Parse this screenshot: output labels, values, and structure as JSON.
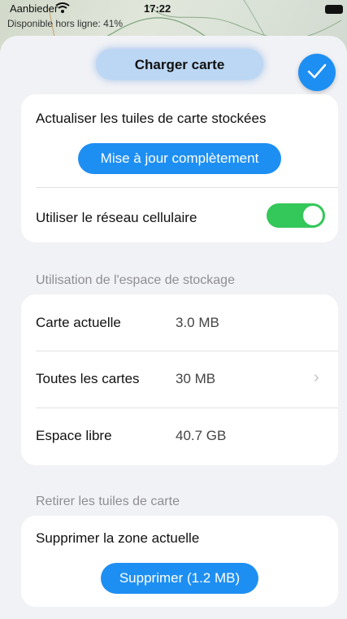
{
  "status_bar": {
    "carrier": "Aanbieder",
    "time": "17:22",
    "offline_notice": "Disponible hors ligne: 41%"
  },
  "header": {
    "title": "Charger carte",
    "done_icon": "checkmark-icon"
  },
  "update_section": {
    "refresh_label": "Actualiser les tuiles de carte stockées",
    "update_button": "Mise à jour complètement",
    "cellular_label": "Utiliser le réseau cellulaire",
    "cellular_enabled": true
  },
  "storage_section": {
    "header": "Utilisation de l'espace de stockage",
    "rows": [
      {
        "label": "Carte actuelle",
        "value": "3.0 MB"
      },
      {
        "label": "Toutes les cartes",
        "value": "30 MB"
      },
      {
        "label": "Espace libre",
        "value": "40.7 GB"
      }
    ]
  },
  "remove_section": {
    "header": "Retirer les tuiles de carte",
    "delete_label": "Supprimer la zone actuelle",
    "delete_button": "Supprimer (1.2 MB)"
  },
  "colors": {
    "accent": "#1e8ff2",
    "toggle_on": "#34c759",
    "background": "#f1f2f6"
  }
}
